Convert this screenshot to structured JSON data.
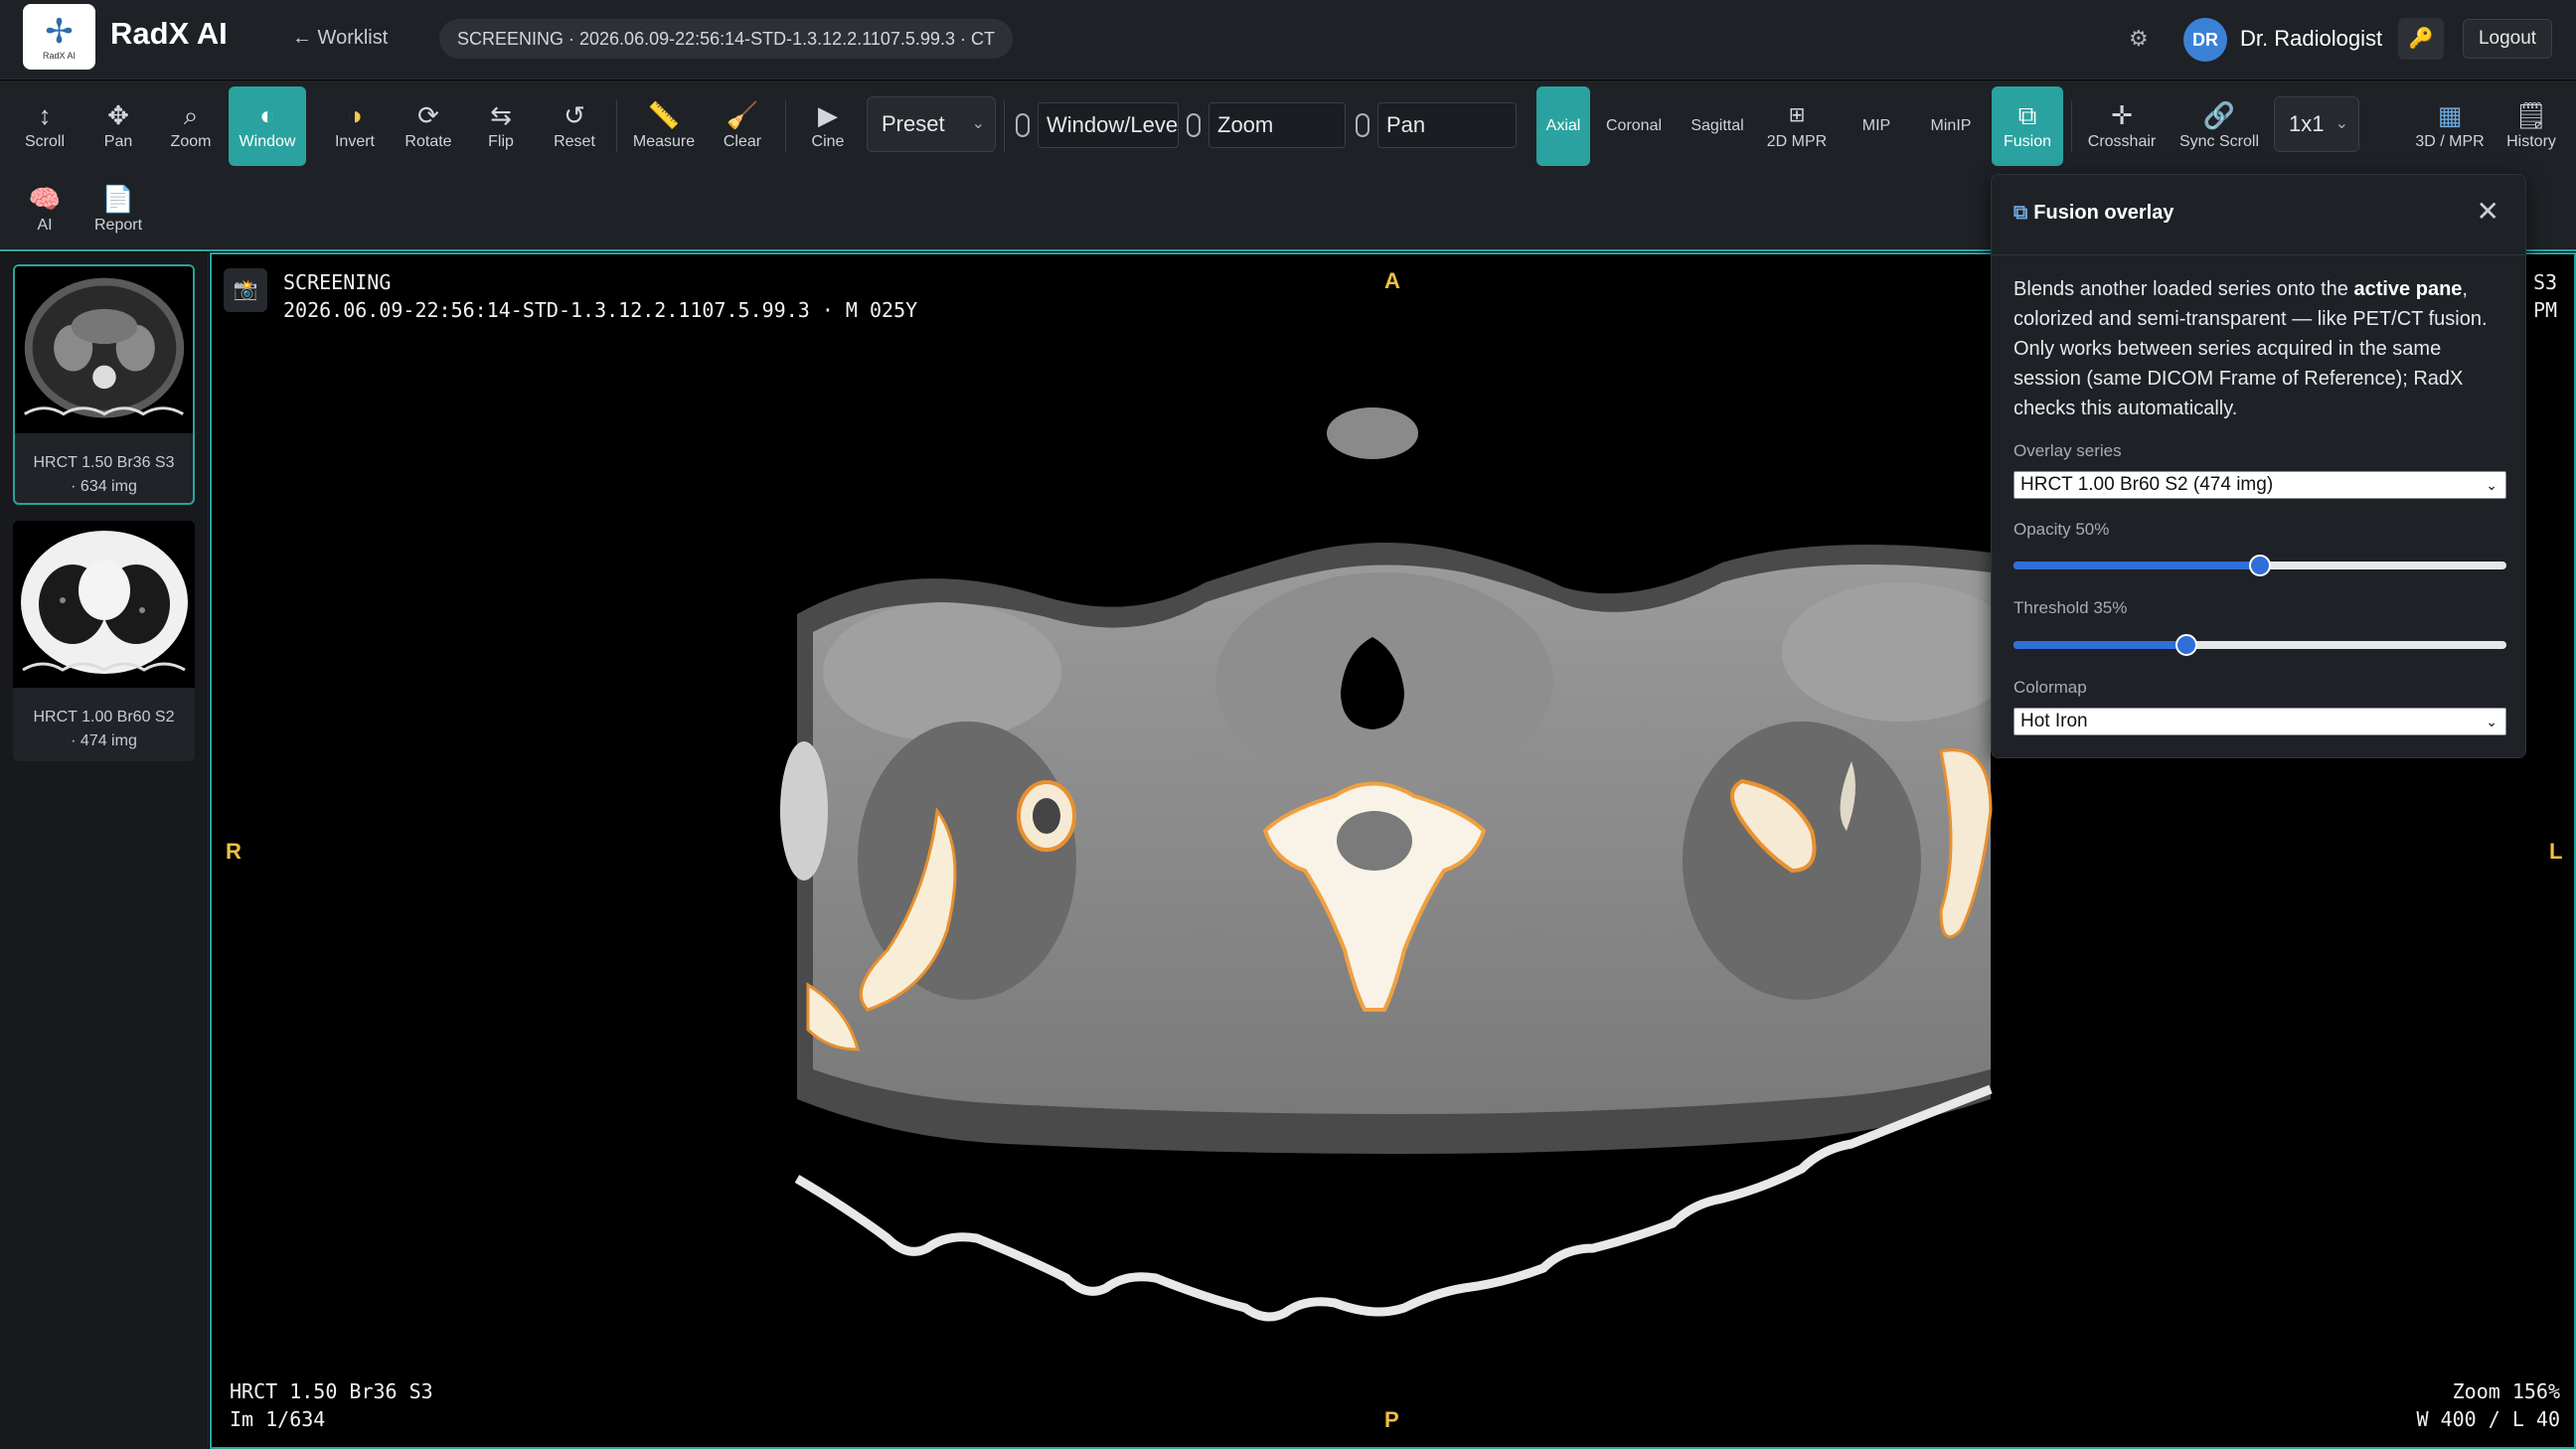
{
  "app": {
    "logo_text": "RadX AI",
    "name": "RadX AI",
    "back_link": "← Worklist",
    "study_pill": "SCREENING · 2026.06.09-22:56:14-STD-1.3.12.2.1107.5.99.3 · CT",
    "user_initials": "DR",
    "user_name": "Dr. Radiologist",
    "logout": "Logout"
  },
  "toolbar": {
    "scroll": "Scroll",
    "pan": "Pan",
    "zoom": "Zoom",
    "window": "Window",
    "invert": "Invert",
    "rotate": "Rotate",
    "flip": "Flip",
    "reset": "Reset",
    "measure": "Measure",
    "clear": "Clear",
    "cine": "Cine",
    "preset": "Preset",
    "mouse_left": "Window/Level",
    "mouse_middle": "Zoom",
    "mouse_right": "Pan",
    "axial": "Axial",
    "coronal": "Coronal",
    "sagittal": "Sagittal",
    "mpr2d": "2D MPR",
    "mip": "MIP",
    "minip": "MinIP",
    "fusion": "Fusion",
    "crosshair": "Crosshair",
    "sync_scroll": "Sync Scroll",
    "layout": "1x1",
    "mpr3d": "3D / MPR",
    "history": "History",
    "ai": "AI",
    "report": "Report"
  },
  "series": [
    {
      "line1": "HRCT 1.50 Br36 S3",
      "line2": "· 634 img"
    },
    {
      "line1": "HRCT 1.00 Br60 S2",
      "line2": "· 474 img"
    }
  ],
  "viewer": {
    "patient_label": "SCREENING",
    "study_line": "2026.06.09-22:56:14-STD-1.3.12.2.1107.5.99.3 · M 025Y",
    "right_top1": "S3",
    "right_top2": "PM",
    "orient_top": "A",
    "orient_left": "R",
    "orient_right": "L",
    "orient_bottom": "P",
    "series_name": "HRCT 1.50 Br36 S3",
    "image_index": "Im 1/634",
    "zoom": "Zoom 156%",
    "window_level": "W 400 / L 40"
  },
  "fusion": {
    "title": "Fusion overlay",
    "desc_pre": "Blends another loaded series onto the ",
    "desc_bold": "active pane",
    "desc_post": ", colorized and semi-transparent — like PET/CT fusion. Only works between series acquired in the same session (same DICOM Frame of Reference); RadX checks this automatically.",
    "overlay_label": "Overlay series",
    "overlay_value": "HRCT 1.00 Br60 S2 (474 img)",
    "opacity_label": "Opacity 50%",
    "opacity": 0.5,
    "threshold_label": "Threshold 35%",
    "threshold": 0.35,
    "colormap_label": "Colormap",
    "colormap_value": "Hot Iron"
  },
  "colors": {
    "accent": "#2aa3a0",
    "slider": "#2f6fd8",
    "orientation": "#f0c040"
  }
}
